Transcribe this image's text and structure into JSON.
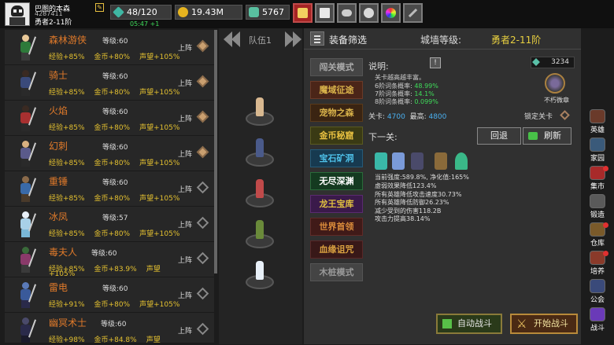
{
  "player": {
    "name": "巴图的本森",
    "id": "4287411",
    "rank": "勇者2-11阶"
  },
  "resources": {
    "energy": "48/120",
    "gold": "19.43M",
    "gems": "5767"
  },
  "timer": "05:47 +1",
  "heroes": [
    {
      "name": "森林游侠",
      "level": "等级:60",
      "exp": "经验+85%",
      "gold": "金币+80%",
      "fame": "声望+105%",
      "deploy": "上阵",
      "deployed": true,
      "colors": [
        "#e8c898",
        "#2e7a3a",
        "#3a3a3a"
      ]
    },
    {
      "name": "骑士",
      "level": "等级:60",
      "exp": "经验+85%",
      "gold": "金币+80%",
      "fame": "声望+105%",
      "deploy": "上阵",
      "deployed": true,
      "colors": [
        "#3a2a22",
        "#3a4a7a",
        "#2a2a2a"
      ]
    },
    {
      "name": "火焰",
      "level": "等级:60",
      "exp": "经验+85%",
      "gold": "金币+80%",
      "fame": "声望+105%",
      "deploy": "上阵",
      "deployed": true,
      "colors": [
        "#3a2a22",
        "#a83030",
        "#2a2a2a"
      ]
    },
    {
      "name": "幻刺",
      "level": "等级:60",
      "exp": "经验+85%",
      "gold": "金币+80%",
      "fame": "声望+105%",
      "deploy": "上阵",
      "deployed": true,
      "colors": [
        "#d8b080",
        "#5a5a8a",
        "#2a2a2a"
      ]
    },
    {
      "name": "重锤",
      "level": "等级:60",
      "exp": "经验+85%",
      "gold": "金币+80%",
      "fame": "声望+105%",
      "deploy": "上阵",
      "deployed": false,
      "colors": [
        "#8a6a4a",
        "#3a6aa8",
        "#4a3a2a"
      ]
    },
    {
      "name": "冰凤",
      "level": "等级:57",
      "exp": "经验+85%",
      "gold": "金币+80%",
      "fame": "声望+105%",
      "deploy": "上阵",
      "deployed": false,
      "colors": [
        "#e8f0f8",
        "#a8d0e8",
        "#7ab8d8"
      ]
    },
    {
      "name": "毒夫人",
      "level": "等级:60",
      "exp": "经验+85%",
      "gold": "金币+83.9%",
      "fame": "声望",
      "fame2": "+105%",
      "deploy": "上阵",
      "deployed": false,
      "colors": [
        "#3a6a3a",
        "#8a3a6a",
        "#3a3a3a"
      ]
    },
    {
      "name": "雷电",
      "level": "等级:60",
      "exp": "经验+91%",
      "gold": "金币+80%",
      "fame": "声望+105%",
      "deploy": "上阵",
      "deployed": false,
      "colors": [
        "#5a7ab8",
        "#3a5a9a",
        "#2a2a4a"
      ]
    },
    {
      "name": "幽冥术士",
      "level": "等级:60",
      "exp": "经验+98%",
      "gold": "金币+84.8%",
      "fame": "声望",
      "deploy": "上阵",
      "deployed": false,
      "colors": [
        "#4a4a6a",
        "#2a2a4a",
        "#1a1a2a"
      ]
    }
  ],
  "team": {
    "label": "队伍1",
    "members": [
      {
        "color": "#d8b890"
      },
      {
        "color": "#4a5a8a"
      },
      {
        "color": "#c04a4a"
      },
      {
        "color": "#6a8a3a"
      },
      {
        "color": "#e8f0f8"
      }
    ]
  },
  "main": {
    "filter_label": "装备筛选",
    "city_level_label": "城墙等级:",
    "city_level": "勇者2-11阶",
    "modes": [
      "闯关模式",
      "魔域征途",
      "宠物之森",
      "金币秘窟",
      "宝石矿洞",
      "无尽深渊",
      "龙王宝库",
      "世界首领",
      "血缘诅咒",
      "木桩模式"
    ],
    "desc_label": "说明:",
    "info": "!",
    "gem_count": "3234",
    "desc_text": "关卡越高越丰富。",
    "drops": [
      {
        "label": "6阶词条概率:",
        "value": "48.99%"
      },
      {
        "label": "7阶词条概率:",
        "value": "14.1%"
      },
      {
        "label": "8阶词条概率:",
        "value": "0.099%"
      }
    ],
    "emblem_label": "不朽微章",
    "level_label": "关卡:",
    "level_value": "4700",
    "best_label": "最高:",
    "best_value": "4800",
    "lock_label": "锁定关卡",
    "next_label": "下一关:",
    "back_label": "回退",
    "refresh_label": "刷新",
    "enemy_colors": [
      "#3ab8a8",
      "#7a9ad8",
      "#4a4a6a",
      "#8a6a3a",
      "#3ab888"
    ],
    "stats": [
      "当前强度:589.8%, 净化值:165%",
      "虚弱效果降低123.4%",
      "所有英雄降低攻击速度30.73%",
      "所有英雄降低防御26.23%",
      "减少受到的伤害118.2B",
      "攻击力提高38.14%"
    ],
    "auto_label": "自动战斗",
    "start_label": "开始战斗"
  },
  "sidebar": [
    {
      "label": "英雄",
      "icon": "#6a3a2a",
      "dot": false
    },
    {
      "label": "家园",
      "icon": "#3a5a7a",
      "dot": false
    },
    {
      "label": "集市",
      "icon": "#a82a2a",
      "dot": true
    },
    {
      "label": "锻造",
      "icon": "#5a5a5a",
      "dot": false
    },
    {
      "label": "仓库",
      "icon": "#7a5a2a",
      "dot": true
    },
    {
      "label": "培养",
      "icon": "#8a3a2a",
      "dot": true
    },
    {
      "label": "公会",
      "icon": "#3a4a7a",
      "dot": false
    },
    {
      "label": "战斗",
      "icon": "#6a3ab8",
      "dot": false
    }
  ]
}
